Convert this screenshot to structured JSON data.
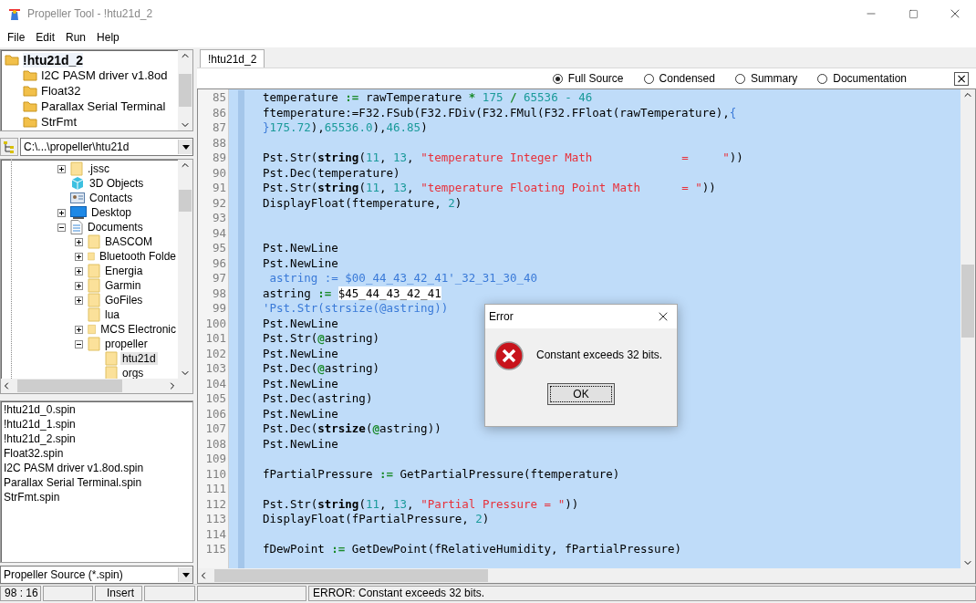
{
  "window": {
    "title": "Propeller Tool - !htu21d_2"
  },
  "menu": [
    "File",
    "Edit",
    "Run",
    "Help"
  ],
  "project_tree": {
    "root": "!htu21d_2",
    "children": [
      "I2C PASM driver v1.8od",
      "Float32",
      "Parallax Serial Terminal",
      "StrFmt"
    ]
  },
  "path_combo": {
    "value": "C:\\...\\propeller\\htu21d"
  },
  "folder_tree": [
    {
      "label": ".jssc",
      "kind": "folder",
      "expanded": false,
      "selected": false
    },
    {
      "label": "3D Objects",
      "kind": "objects",
      "selected": false
    },
    {
      "label": "Contacts",
      "kind": "contacts",
      "selected": false
    },
    {
      "label": "Desktop",
      "kind": "desktop",
      "expanded": false,
      "selected": false
    },
    {
      "label": "Documents",
      "kind": "documents",
      "expanded": true,
      "selected": false,
      "children": [
        {
          "label": "BASCOM",
          "kind": "folder",
          "expanded": false,
          "selected": false
        },
        {
          "label": "Bluetooth Folde",
          "kind": "folder",
          "expanded": false,
          "selected": false
        },
        {
          "label": "Energia",
          "kind": "folder",
          "expanded": false,
          "selected": false
        },
        {
          "label": "Garmin",
          "kind": "folder",
          "expanded": false,
          "selected": false
        },
        {
          "label": "GoFiles",
          "kind": "folder",
          "expanded": false,
          "selected": false
        },
        {
          "label": "lua",
          "kind": "folder",
          "selected": false
        },
        {
          "label": "MCS Electronic",
          "kind": "folder",
          "expanded": false,
          "selected": false
        },
        {
          "label": "propeller",
          "kind": "folder",
          "expanded": true,
          "selected": false,
          "children": [
            {
              "label": "htu21d",
              "kind": "folder",
              "selected": true
            },
            {
              "label": "orgs",
              "kind": "folder",
              "selected": false
            }
          ]
        }
      ]
    }
  ],
  "files": [
    "!htu21d_0.spin",
    "!htu21d_1.spin",
    "!htu21d_2.spin",
    "Float32.spin",
    "I2C PASM driver v1.8od.spin",
    "Parallax Serial Terminal.spin",
    "StrFmt.spin"
  ],
  "filter_combo": {
    "value": "Propeller Source (*.spin)"
  },
  "tabs": [
    {
      "label": "!htu21d_2",
      "selected": true
    }
  ],
  "view_options": [
    {
      "label": "Full Source",
      "selected": true
    },
    {
      "label": "Condensed",
      "selected": false
    },
    {
      "label": "Summary",
      "selected": false
    },
    {
      "label": "Documentation",
      "selected": false
    }
  ],
  "close_glyph": "×",
  "code": [
    {
      "no": "85",
      "tokens": [
        {
          "kind": "p",
          "text": "temperature "
        },
        {
          "kind": "o",
          "text": ":="
        },
        {
          "kind": "p",
          "text": " rawTemperature "
        },
        {
          "kind": "o",
          "text": "*"
        },
        {
          "kind": "n",
          "text": " 175 "
        },
        {
          "kind": "o",
          "text": "/"
        },
        {
          "kind": "n",
          "text": " 65536 - 46"
        }
      ]
    },
    {
      "no": "86",
      "tokens": [
        {
          "kind": "p",
          "text": "ftemperature:=F32.FSub(F32.FDiv(F32.FMul(F32.FFloat(rawTemperature),"
        },
        {
          "kind": "c",
          "text": "{"
        }
      ]
    },
    {
      "no": "87",
      "tokens": [
        {
          "kind": "c",
          "text": "}"
        },
        {
          "kind": "n",
          "text": "175.72"
        },
        {
          "kind": "p",
          "text": "),"
        },
        {
          "kind": "n",
          "text": "65536.0"
        },
        {
          "kind": "p",
          "text": "),"
        },
        {
          "kind": "n",
          "text": "46.85"
        },
        {
          "kind": "p",
          "text": ")"
        }
      ]
    },
    {
      "no": "88"
    },
    {
      "no": "89",
      "tokens": [
        {
          "kind": "p",
          "text": "Pst.Str("
        },
        {
          "kind": "k",
          "text": "string"
        },
        {
          "kind": "p",
          "text": "("
        },
        {
          "kind": "n",
          "text": "11"
        },
        {
          "kind": "p",
          "text": ", "
        },
        {
          "kind": "n",
          "text": "13"
        },
        {
          "kind": "p",
          "text": ", "
        },
        {
          "kind": "s",
          "text": "\"temperature Integer Math             =     \""
        },
        {
          "kind": "p",
          "text": "))"
        }
      ]
    },
    {
      "no": "90",
      "tokens": [
        {
          "kind": "p",
          "text": "Pst.Dec(temperature)"
        }
      ]
    },
    {
      "no": "91",
      "tokens": [
        {
          "kind": "p",
          "text": "Pst.Str("
        },
        {
          "kind": "k",
          "text": "string"
        },
        {
          "kind": "p",
          "text": "("
        },
        {
          "kind": "n",
          "text": "11"
        },
        {
          "kind": "p",
          "text": ", "
        },
        {
          "kind": "n",
          "text": "13"
        },
        {
          "kind": "p",
          "text": ", "
        },
        {
          "kind": "s",
          "text": "\"temperature Floating Point Math      = \""
        },
        {
          "kind": "p",
          "text": "))"
        }
      ]
    },
    {
      "no": "92",
      "tokens": [
        {
          "kind": "p",
          "text": "DisplayFloat(ftemperature, "
        },
        {
          "kind": "n",
          "text": "2"
        },
        {
          "kind": "p",
          "text": ")"
        }
      ]
    },
    {
      "no": "93"
    },
    {
      "no": "94"
    },
    {
      "no": "95",
      "tokens": [
        {
          "kind": "p",
          "text": "Pst.NewLine"
        }
      ]
    },
    {
      "no": "96",
      "tokens": [
        {
          "kind": "p",
          "text": "Pst.NewLine"
        }
      ]
    },
    {
      "no": "97",
      "tokens": [
        {
          "kind": "c",
          "text": " astring := $00_44_43_42_41'_32_31_30_40"
        }
      ]
    },
    {
      "no": "98",
      "tokens": [
        {
          "kind": "p",
          "text": "astring "
        },
        {
          "kind": "o",
          "text": ":= "
        },
        {
          "kind": "h",
          "text": "$45_44_43_42_41"
        }
      ]
    },
    {
      "no": "99",
      "tokens": [
        {
          "kind": "c",
          "text": "'Pst.Str(strsize(@astring))"
        }
      ]
    },
    {
      "no": "100",
      "tokens": [
        {
          "kind": "p",
          "text": "Pst.NewLine"
        }
      ]
    },
    {
      "no": "101",
      "tokens": [
        {
          "kind": "p",
          "text": "Pst.Str("
        },
        {
          "kind": "o",
          "text": "@"
        },
        {
          "kind": "p",
          "text": "astring)"
        }
      ]
    },
    {
      "no": "102",
      "tokens": [
        {
          "kind": "p",
          "text": "Pst.NewLine"
        }
      ]
    },
    {
      "no": "103",
      "tokens": [
        {
          "kind": "p",
          "text": "Pst.Dec("
        },
        {
          "kind": "o",
          "text": "@"
        },
        {
          "kind": "p",
          "text": "astring)"
        }
      ]
    },
    {
      "no": "104",
      "tokens": [
        {
          "kind": "p",
          "text": "Pst.NewLine"
        }
      ]
    },
    {
      "no": "105",
      "tokens": [
        {
          "kind": "p",
          "text": "Pst.Dec(astring)"
        }
      ]
    },
    {
      "no": "106",
      "tokens": [
        {
          "kind": "p",
          "text": "Pst.NewLine"
        }
      ]
    },
    {
      "no": "107",
      "tokens": [
        {
          "kind": "p",
          "text": "Pst.Dec("
        },
        {
          "kind": "k",
          "text": "strsize"
        },
        {
          "kind": "p",
          "text": "("
        },
        {
          "kind": "o",
          "text": "@"
        },
        {
          "kind": "p",
          "text": "astring))"
        }
      ]
    },
    {
      "no": "108",
      "tokens": [
        {
          "kind": "p",
          "text": "Pst.NewLine"
        }
      ]
    },
    {
      "no": "109"
    },
    {
      "no": "110",
      "tokens": [
        {
          "kind": "p",
          "text": "fPartialPressure "
        },
        {
          "kind": "o",
          "text": ":="
        },
        {
          "kind": "p",
          "text": " GetPartialPressure(ftemperature)"
        }
      ]
    },
    {
      "no": "111"
    },
    {
      "no": "112",
      "tokens": [
        {
          "kind": "p",
          "text": "Pst.Str("
        },
        {
          "kind": "k",
          "text": "string"
        },
        {
          "kind": "p",
          "text": "("
        },
        {
          "kind": "n",
          "text": "11"
        },
        {
          "kind": "p",
          "text": ", "
        },
        {
          "kind": "n",
          "text": "13"
        },
        {
          "kind": "p",
          "text": ", "
        },
        {
          "kind": "s",
          "text": "\"Partial Pressure = \""
        },
        {
          "kind": "p",
          "text": "))"
        }
      ]
    },
    {
      "no": "113",
      "tokens": [
        {
          "kind": "p",
          "text": "DisplayFloat(fPartialPressure, "
        },
        {
          "kind": "n",
          "text": "2"
        },
        {
          "kind": "p",
          "text": ")"
        }
      ]
    },
    {
      "no": "114"
    },
    {
      "no": "115",
      "tokens": [
        {
          "kind": "p",
          "text": "fDewPoint "
        },
        {
          "kind": "o",
          "text": ":="
        },
        {
          "kind": "p",
          "text": " GetDewPoint(fRelativeHumidity, fPartialPressure)"
        }
      ]
    }
  ],
  "dialog": {
    "title": "Error",
    "message": "Constant exceeds 32 bits.",
    "button": "OK"
  },
  "status_bar": {
    "position": "98 : 16",
    "mode": "Insert",
    "message": "ERROR: Constant exceeds 32 bits."
  }
}
